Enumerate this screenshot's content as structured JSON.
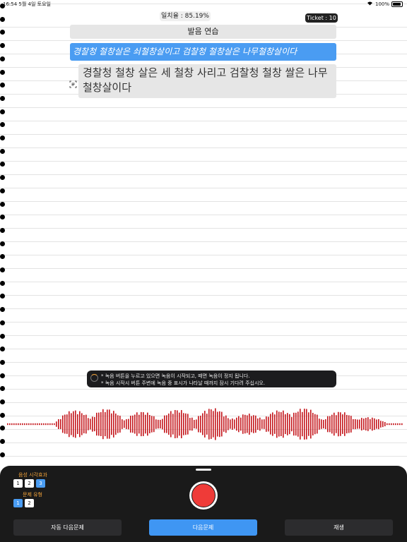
{
  "status_bar": {
    "time": "16:54",
    "date": "5월 4일 토요일",
    "battery": "100%"
  },
  "header": {
    "match_rate": "일치율 : 85.19%",
    "ticket": "Ticket : 10"
  },
  "practice": {
    "title": "발음 연습",
    "target_sentence": "경찰청 철창살은 쇠철창살이고 검찰청 철창살은 나무철창살이다",
    "recognized_text": "경찰청 철창 살은 세 철창 사리고 검찰청 철창 쌀은 나무 철창살이다"
  },
  "hint": {
    "line1": "* 녹음 버튼을 누르고 있으면 녹음이 시작되고, 떼면 녹음이 정지 됩니다.",
    "line2": "* 녹음 시작시 버튼 주변에 녹음 중 표시가 나타날 때까지 잠시 기다려 주십시오."
  },
  "waveform": {
    "color": "#c4161c"
  },
  "controls": {
    "voice_effect_label": "음성 시각효과",
    "voice_effect_options": [
      "1",
      "2",
      "3"
    ],
    "voice_effect_selected": 2,
    "question_type_label": "문제 유형",
    "question_type_options": [
      "1",
      "2"
    ],
    "question_type_selected": 0,
    "auto_next_label": "자동 다음문제",
    "next_label": "다음문제",
    "play_label": "재생"
  },
  "colors": {
    "accent": "#4a9cf2",
    "record": "#ef3b38",
    "panel": "#1a1a1a",
    "label": "#f2a33a"
  }
}
